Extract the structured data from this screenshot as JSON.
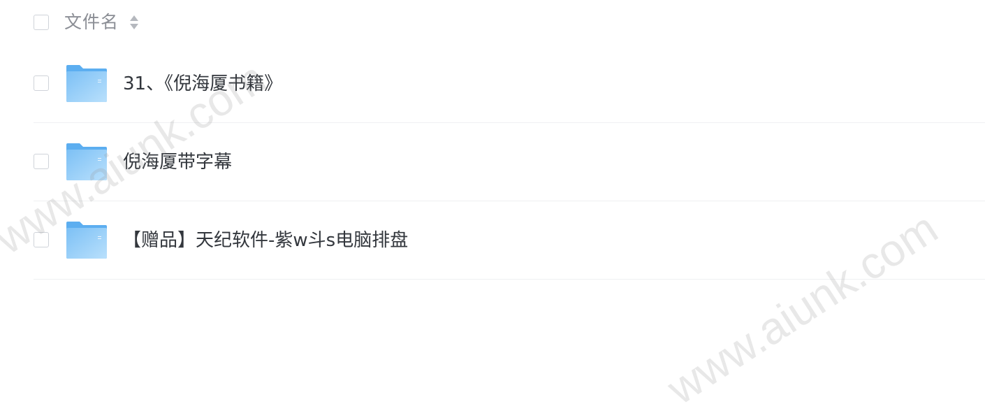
{
  "header": {
    "column_label": "文件名",
    "sort_icon": "sort-icon"
  },
  "files": [
    {
      "name": "31、《倪海厦书籍》",
      "type": "folder",
      "icon": "folder-icon"
    },
    {
      "name": "倪海厦带字幕",
      "type": "folder",
      "icon": "folder-icon"
    },
    {
      "name": "【赠品】天纪软件-紫w斗s电脑排盘",
      "type": "folder",
      "icon": "folder-icon"
    }
  ],
  "watermarks": [
    "www.aiunk.com",
    "www.aiunk.com"
  ],
  "colors": {
    "folder_light": "#a9d8fb",
    "folder_dark": "#5caef0",
    "text": "#33373d",
    "header_text": "#8b8e95",
    "divider": "#eff0f2"
  }
}
